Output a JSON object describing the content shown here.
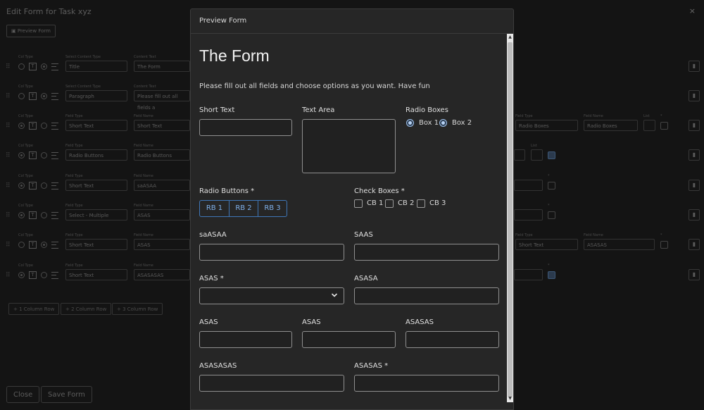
{
  "background": {
    "title": "Edit Form for Task xyz",
    "close_symbol": "×",
    "preview_button": "Preview Form",
    "rows": [
      {
        "col_type_label": "Col Type",
        "type_label": "Select Content Type",
        "type_value": "Title",
        "name_label": "Content Text",
        "name_value": "The Form"
      },
      {
        "col_type_label": "Col Type",
        "type_label": "Select Content Type",
        "type_value": "Paragraph",
        "name_label": "Content Text",
        "name_value": "Please fill out all fields a"
      },
      {
        "col_type_label": "Col Type",
        "type_label": "Field Type",
        "type_value": "Short Text",
        "name_label": "Field Name",
        "name_value": "Short Text",
        "right_type_label": "Field Type",
        "right_type_value": "Radio Boxes",
        "right_name_label": "Field Name",
        "right_name_value": "Radio Boxes",
        "list_label": "List",
        "req_label": "*"
      },
      {
        "col_type_label": "Col Type",
        "type_label": "Field Type",
        "type_value": "Radio Buttons",
        "name_label": "Field Name",
        "name_value": "Radio Buttons",
        "list_label": "List"
      },
      {
        "col_type_label": "Col Type",
        "type_label": "Field Type",
        "type_value": "Short Text",
        "name_label": "Field Name",
        "name_value": "saASAA",
        "req_label": "*"
      },
      {
        "col_type_label": "Col Type",
        "type_label": "Field Type",
        "type_value": "Select - Multiple",
        "name_label": "Field Name",
        "name_value": "ASAS",
        "req_label": "*"
      },
      {
        "col_type_label": "Col Type",
        "type_label": "Field Type",
        "type_value": "Short Text",
        "name_label": "Field Name",
        "name_value": "ASAS",
        "right_type_label": "Field Type",
        "right_type_value": "Short Text",
        "right_name_label": "Field Name",
        "right_name_value": "ASASAS",
        "req_label": "*"
      },
      {
        "col_type_label": "Col Type",
        "type_label": "Field Type",
        "type_value": "Short Text",
        "name_label": "Field Name",
        "name_value": "ASASASAS",
        "req_label": "*"
      }
    ],
    "add_buttons": [
      "+ 1 Column Row",
      "+ 2 Column Row",
      "+ 3 Column Row"
    ],
    "footer": {
      "close": "Close",
      "save": "Save Form"
    }
  },
  "modal": {
    "header": "Preview Form",
    "form_title": "The Form",
    "description": "Please fill out all fields and choose options as you want. Have fun",
    "short_text_label": "Short Text",
    "text_area_label": "Text Area",
    "radio_boxes_label": "Radio Boxes",
    "radio_boxes": [
      "Box 1",
      "Box 2"
    ],
    "radio_buttons_label": "Radio Buttons *",
    "radio_buttons": [
      "RB 1",
      "RB 2",
      "RB 3"
    ],
    "check_boxes_label": "Check Boxes *",
    "check_boxes": [
      "CB 1",
      "CB 2",
      "CB 3"
    ],
    "row3": {
      "left": "saASAA",
      "right": "SAAS"
    },
    "row4": {
      "left": "ASAS *",
      "right": "ASASA"
    },
    "row5": {
      "a": "ASAS",
      "b": "ASAS",
      "c": "ASASAS"
    },
    "row6": {
      "left": "ASASASAS",
      "right": "ASASAS *"
    }
  }
}
